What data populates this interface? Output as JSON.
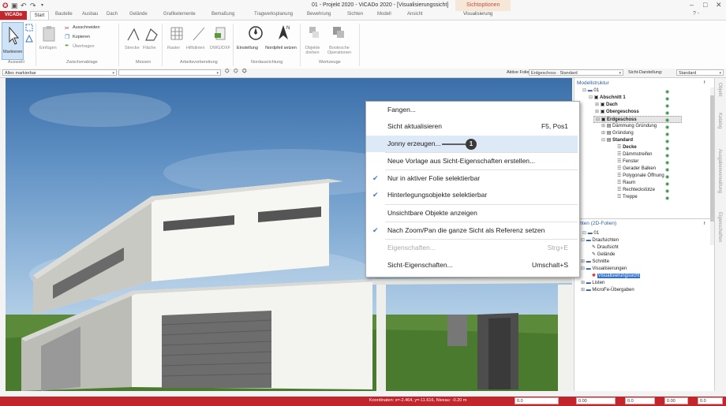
{
  "titlebar": {
    "title": "01 - Projekt 2020 - ViCADo 2020 - [Visualisierungssicht]",
    "context_group": "Sichtoptionen",
    "window_controls": [
      "–",
      "□",
      "✕"
    ]
  },
  "tabs": {
    "app_tab": "ViCADo",
    "items": [
      "Start",
      "Bauteile",
      "Ausbau",
      "Dach",
      "Gelände",
      "Grafikelemente",
      "Bemaßung",
      "Tragwerksplanung",
      "Bewehrung",
      "Sichten",
      "Modell",
      "Ansicht",
      "Visualisierung"
    ],
    "help": "? -"
  },
  "ribbon": {
    "groups": [
      {
        "label": "Auswahl",
        "buttons": [
          "Markieren"
        ]
      },
      {
        "label": "Zwischenablage",
        "buttons": [
          "Einfügen",
          "Ausschneiden",
          "Kopieren",
          "Übertragen"
        ]
      },
      {
        "label": "Messen",
        "buttons": [
          "Strecke",
          "Fläche"
        ]
      },
      {
        "label": "Arbeitsvorbereitung",
        "buttons": [
          "Raster",
          "Hilfslinien",
          "DWG/DXF"
        ]
      },
      {
        "label": "Nordausrichtung",
        "buttons": [
          "Einstellung",
          "Nordpfeil setzen"
        ]
      },
      {
        "label": "Werkzeuge",
        "buttons": [
          "Objekte drehen",
          "Boolesche Operationen"
        ]
      }
    ]
  },
  "toolbar2": {
    "filter_value": "Alles markierbar",
    "active_layer_label": "Aktive Folie:",
    "active_layer_value": "Erdgeschoss : Standard",
    "view_display_label": "Sicht-Darstellung:",
    "view_display_value": "Standard"
  },
  "context_menu": {
    "items": [
      {
        "label": "Fangen...",
        "shortcut": "",
        "checked": false,
        "disabled": false
      },
      {
        "label": "Sicht aktualisieren",
        "shortcut": "F5, Pos1",
        "checked": false,
        "disabled": false
      },
      {
        "label": "Jonny erzeugen...",
        "shortcut": "",
        "checked": false,
        "disabled": false,
        "highlighted": true
      },
      {
        "label": "Neue Vorlage aus Sicht-Eigenschaften erstellen...",
        "shortcut": "",
        "checked": false,
        "disabled": false
      },
      {
        "label": "Nur in aktiver Folie selektierbar",
        "shortcut": "",
        "checked": true,
        "disabled": false
      },
      {
        "label": "Hinterlegungsobjekte selektierbar",
        "shortcut": "",
        "checked": true,
        "disabled": false
      },
      {
        "label": "Unsichtbare Objekte anzeigen",
        "shortcut": "",
        "checked": false,
        "disabled": false
      },
      {
        "label": "Nach Zoom/Pan die ganze Sicht als Referenz setzen",
        "shortcut": "",
        "checked": true,
        "disabled": false
      },
      {
        "label": "Eigenschaften...",
        "shortcut": "Strg+E",
        "checked": false,
        "disabled": true
      },
      {
        "label": "Sicht-Eigenschaften...",
        "shortcut": "Umschalt+S",
        "checked": false,
        "disabled": false
      }
    ],
    "callout_number": "1"
  },
  "model_panel": {
    "title": "Modellstruktur",
    "pin": "ᵻ",
    "tree": [
      "01",
      "Abschnitt 1",
      "Dach",
      "Obergeschoss",
      "Erdgeschoss",
      "Dämmung Gründung",
      "Gründung",
      "Standard",
      "Decke",
      "Dämmstreifen",
      "Fenster",
      "Gerader Balken",
      "Polygonale Öffnung",
      "Raum",
      "Rechteckstütze",
      "Treppe"
    ],
    "views_title": "chten (2D-Folien)",
    "views_tree": [
      "01",
      "Draufsichten",
      "Draufsicht",
      "Gelände",
      "Schnitte",
      "Visualisierungen",
      "Visualisierungssicht",
      "Listen",
      "MicroFe-Übergaben"
    ]
  },
  "right_strip": [
    "Objekt",
    "Katalog",
    "Ausgabenverwaltung",
    "Eigenschaften"
  ],
  "statusbar": {
    "coordinates": "Koordinaten: x=-2.464, y=-11.616, Niveau: -0.20 m",
    "fields": [
      "0.0",
      "0.00",
      "0.0",
      "0.00",
      "0.0"
    ]
  },
  "colors": {
    "accent": "#c0262c",
    "highlight": "#dde9f7",
    "check": "#3a77c9"
  }
}
